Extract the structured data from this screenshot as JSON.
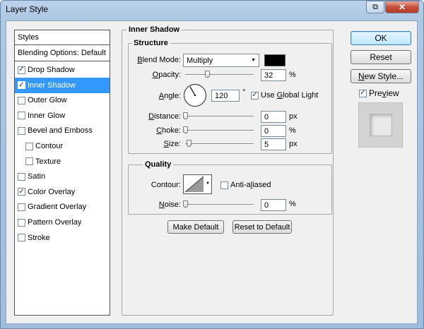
{
  "window": {
    "title": "Layer Style",
    "close_glyph": "✕",
    "restore_glyph": "⧉"
  },
  "styles_panel": {
    "header": "Styles",
    "blending": "Blending Options: Default",
    "items": [
      {
        "label": "Drop Shadow",
        "checked": true,
        "selected": false,
        "sub": false
      },
      {
        "label": "Inner Shadow",
        "checked": true,
        "selected": true,
        "sub": false
      },
      {
        "label": "Outer Glow",
        "checked": false,
        "selected": false,
        "sub": false
      },
      {
        "label": "Inner Glow",
        "checked": false,
        "selected": false,
        "sub": false
      },
      {
        "label": "Bevel and Emboss",
        "checked": false,
        "selected": false,
        "sub": false
      },
      {
        "label": "Contour",
        "checked": false,
        "selected": false,
        "sub": true
      },
      {
        "label": "Texture",
        "checked": false,
        "selected": false,
        "sub": true
      },
      {
        "label": "Satin",
        "checked": false,
        "selected": false,
        "sub": false
      },
      {
        "label": "Color Overlay",
        "checked": true,
        "selected": false,
        "sub": false
      },
      {
        "label": "Gradient Overlay",
        "checked": false,
        "selected": false,
        "sub": false
      },
      {
        "label": "Pattern Overlay",
        "checked": false,
        "selected": false,
        "sub": false
      },
      {
        "label": "Stroke",
        "checked": false,
        "selected": false,
        "sub": false
      }
    ]
  },
  "inner_shadow": {
    "title": "Inner Shadow",
    "structure": {
      "title": "Structure",
      "blend_mode_label_u": "B",
      "blend_mode_label_rest": "lend Mode:",
      "blend_mode_value": "Multiply",
      "shadow_color": "#000000",
      "opacity_label_u": "O",
      "opacity_label_rest": "pacity:",
      "opacity_value": "32",
      "opacity_unit": "%",
      "opacity_level": 0.32,
      "angle_label_u": "A",
      "angle_label_rest": "ngle:",
      "angle_value": "120",
      "angle_unit": "°",
      "use_global_light_u": "G",
      "use_global_light_pre": "Use ",
      "use_global_light_post": "lobal Light",
      "use_global_light": true,
      "distance_label_u": "D",
      "distance_label_rest": "istance:",
      "distance_value": "0",
      "distance_unit": "px",
      "choke_label_u": "C",
      "choke_label_rest": "hoke:",
      "choke_value": "0",
      "choke_unit": "%",
      "size_label_u": "S",
      "size_label_rest": "ize:",
      "size_value": "5",
      "size_unit": "px"
    },
    "quality": {
      "title": "Quality",
      "contour_label": "Contour:",
      "anti_aliased_pre": "Anti-a",
      "anti_aliased_u": "l",
      "anti_aliased_post": "iased",
      "anti_aliased": false,
      "noise_label_u": "N",
      "noise_label_rest": "oise:",
      "noise_value": "0",
      "noise_unit": "%"
    },
    "make_default": "Make Default",
    "reset_to_default": "Reset to Default"
  },
  "actions": {
    "ok": "OK",
    "reset": "Reset",
    "new_style_u": "N",
    "new_style_rest": "ew Style...",
    "preview_u": "v",
    "preview_pre": "Pre",
    "preview_post": "iew",
    "preview_checked": true
  },
  "colors": {
    "selection": "#3399ff",
    "shadow": "#000000"
  },
  "icons": {
    "check": "✓",
    "dropdown": "▼"
  }
}
